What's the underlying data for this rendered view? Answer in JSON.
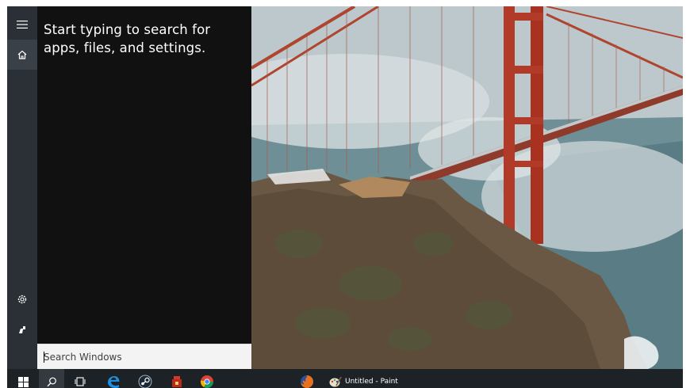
{
  "search_panel": {
    "hint": "Start typing to search for apps, files, and settings."
  },
  "search_box": {
    "placeholder": "Search Windows"
  },
  "rail": {
    "items": [
      {
        "icon": "hamburger-menu-icon"
      },
      {
        "icon": "home-icon"
      },
      {
        "icon": "gear-icon"
      },
      {
        "icon": "feedback-icon"
      }
    ]
  },
  "taskbar": {
    "items": [
      {
        "icon": "windows-start-icon"
      },
      {
        "icon": "search-icon"
      },
      {
        "icon": "task-view-icon"
      },
      {
        "icon": "edge-icon"
      },
      {
        "icon": "steam-icon"
      },
      {
        "icon": "app-icon"
      },
      {
        "icon": "chrome-icon"
      },
      {
        "icon": "firefox-icon"
      },
      {
        "icon": "paint-icon",
        "label": "Untitled - Paint"
      }
    ]
  },
  "colors": {
    "panel_bg": "#111111",
    "rail_bg": "#2b3036",
    "taskbar_bg": "#1d2227",
    "accent": "#76b9ed"
  }
}
